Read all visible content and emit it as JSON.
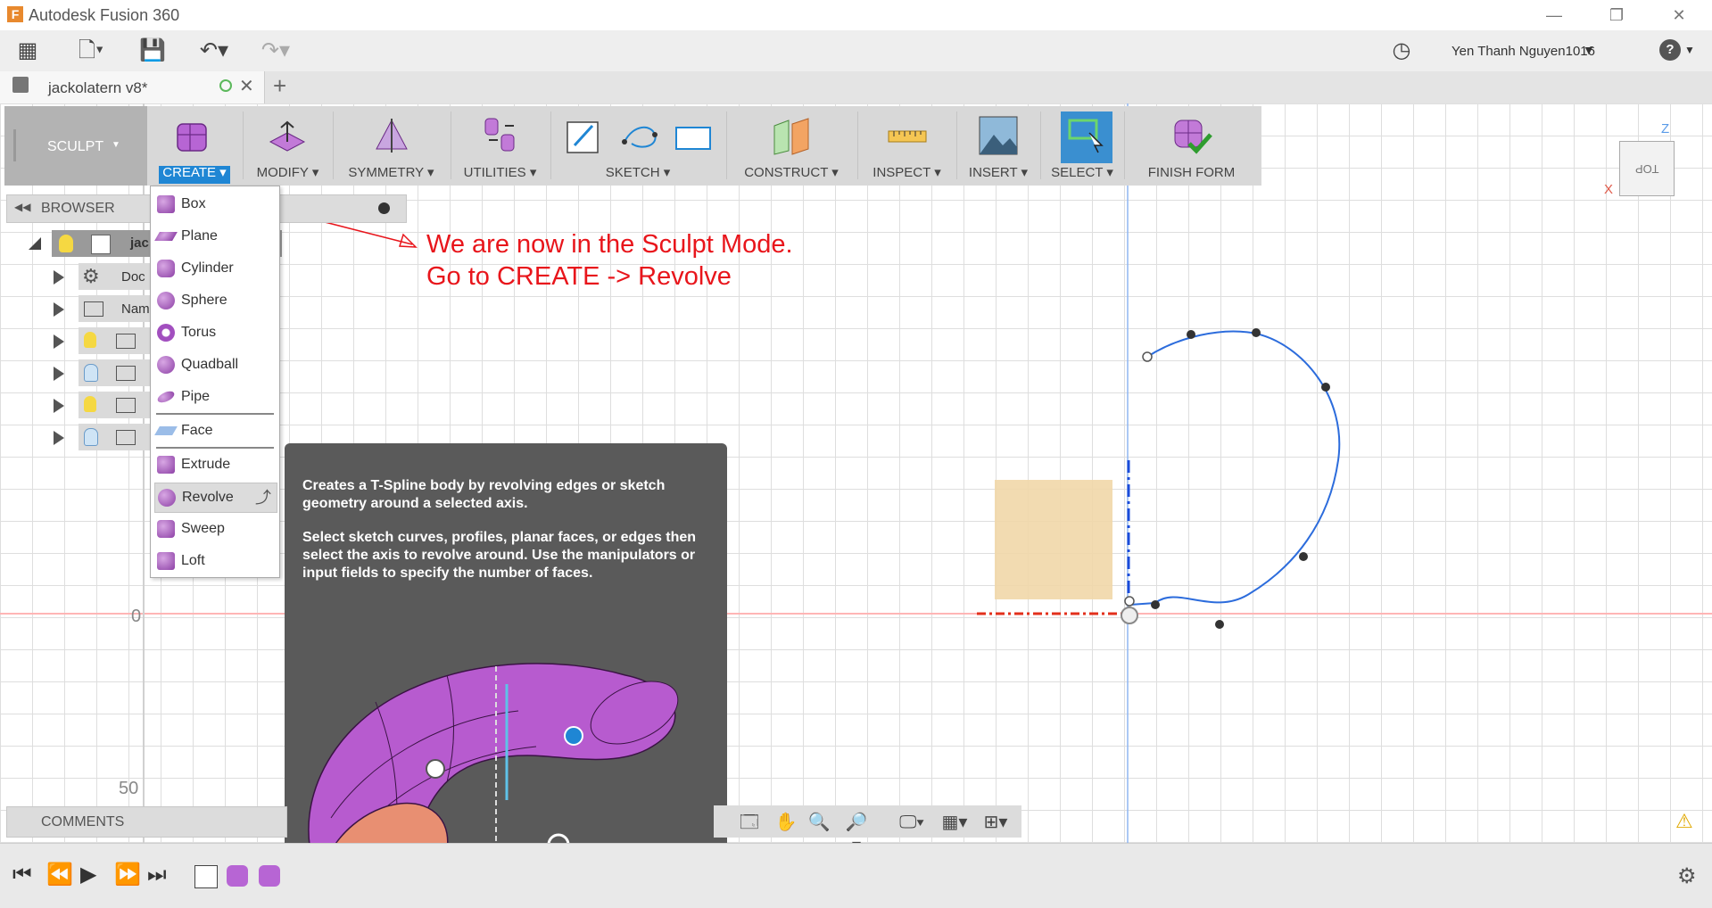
{
  "window": {
    "title": "Autodesk Fusion 360",
    "logo": "F"
  },
  "topbar": {
    "user": "Yen Thanh Nguyen1016",
    "help": "?"
  },
  "document_tab": {
    "name": "jackolatern v8*"
  },
  "workspace": {
    "mode": "SCULPT"
  },
  "ribbon": {
    "groups": [
      {
        "label": "CREATE",
        "icon": "box-icon"
      },
      {
        "label": "MODIFY",
        "icon": "modify-icon"
      },
      {
        "label": "SYMMETRY",
        "icon": "symmetry-icon"
      },
      {
        "label": "UTILITIES",
        "icon": "utilities-icon"
      },
      {
        "label": "SKETCH",
        "icon": "sketch-icon"
      },
      {
        "label": "CONSTRUCT",
        "icon": "construct-icon"
      },
      {
        "label": "INSPECT",
        "icon": "inspect-icon"
      },
      {
        "label": "INSERT",
        "icon": "insert-image-icon"
      },
      {
        "label": "SELECT",
        "icon": "select-icon"
      },
      {
        "label": "FINISH FORM",
        "icon": "finish-form-icon"
      }
    ]
  },
  "browser": {
    "title": "BROWSER",
    "rows": [
      {
        "label": "jac"
      },
      {
        "label": "Doc"
      },
      {
        "label": "Nam"
      },
      {
        "label": ""
      },
      {
        "label": ""
      },
      {
        "label": ""
      },
      {
        "label": ""
      }
    ]
  },
  "create_menu": {
    "items": [
      "Box",
      "Plane",
      "Cylinder",
      "Sphere",
      "Torus",
      "Quadball",
      "Pipe",
      "Face",
      "Extrude",
      "Revolve",
      "Sweep",
      "Loft"
    ]
  },
  "tooltip": {
    "line1": "Creates a T-Spline body by revolving edges or sketch geometry around a selected axis.",
    "line2": "Select sketch curves, profiles, planar faces, or edges then select the axis to revolve around. Use the manipulators or input fields to specify the number of faces."
  },
  "annotation": {
    "line1": "We are now in the Sculpt Mode.",
    "line2": "Go to CREATE -> Revolve",
    "color": "#e8151b"
  },
  "ruler": {
    "zero": "0",
    "fifty": "50"
  },
  "comments": {
    "label": "COMMENTS"
  },
  "viewcube": {
    "face": "TOP",
    "z": "Z",
    "x": "X"
  },
  "colors": {
    "accent": "#1f86d4",
    "sculpt_purple": "#a24fbf",
    "red_axis": "#e3301c",
    "sketch_blue": "#2c6cdc"
  }
}
